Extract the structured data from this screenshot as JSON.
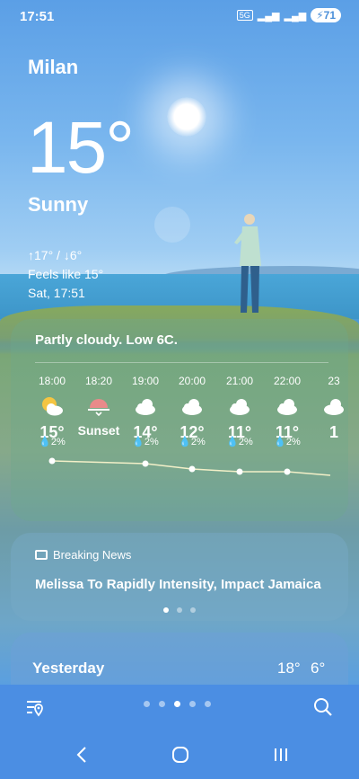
{
  "status": {
    "time": "17:51",
    "network": "5G",
    "battery": "71"
  },
  "weather": {
    "city": "Milan",
    "temperature": "15°",
    "condition": "Sunny",
    "hilo": "↑17° / ↓6°",
    "feels_like": "Feels like 15°",
    "datetime": "Sat, 17:51"
  },
  "hourly": {
    "summary": "Partly cloudy. Low 6C.",
    "items": [
      {
        "time": "18:00",
        "icon": "partly-sunny-icon",
        "temp": "15°",
        "precip": "2%",
        "trend": 15
      },
      {
        "time": "18:20",
        "icon": "sunset-icon",
        "temp": "Sunset",
        "precip": "",
        "trend": null
      },
      {
        "time": "19:00",
        "icon": "cloud-icon",
        "temp": "14°",
        "precip": "2%",
        "trend": 14
      },
      {
        "time": "20:00",
        "icon": "cloud-icon",
        "temp": "12°",
        "precip": "2%",
        "trend": 12
      },
      {
        "time": "21:00",
        "icon": "cloud-icon",
        "temp": "11°",
        "precip": "2%",
        "trend": 11
      },
      {
        "time": "22:00",
        "icon": "cloud-icon",
        "temp": "11°",
        "precip": "2%",
        "trend": 11
      },
      {
        "time": "23",
        "icon": "cloud-icon",
        "temp": "1",
        "precip": "",
        "trend": null
      }
    ]
  },
  "news": {
    "header": "Breaking News",
    "title": "Melissa To Rapidly Intensity, Impact Jamaica",
    "page_count": 3,
    "active_page": 0
  },
  "yesterday": {
    "label": "Yesterday",
    "high": "18°",
    "low": "6°"
  },
  "locations": {
    "count": 5,
    "active": 2
  },
  "colors": {
    "accent": "#4b8ee3",
    "sunset": "#e98a8a",
    "sun": "#f4c542"
  }
}
